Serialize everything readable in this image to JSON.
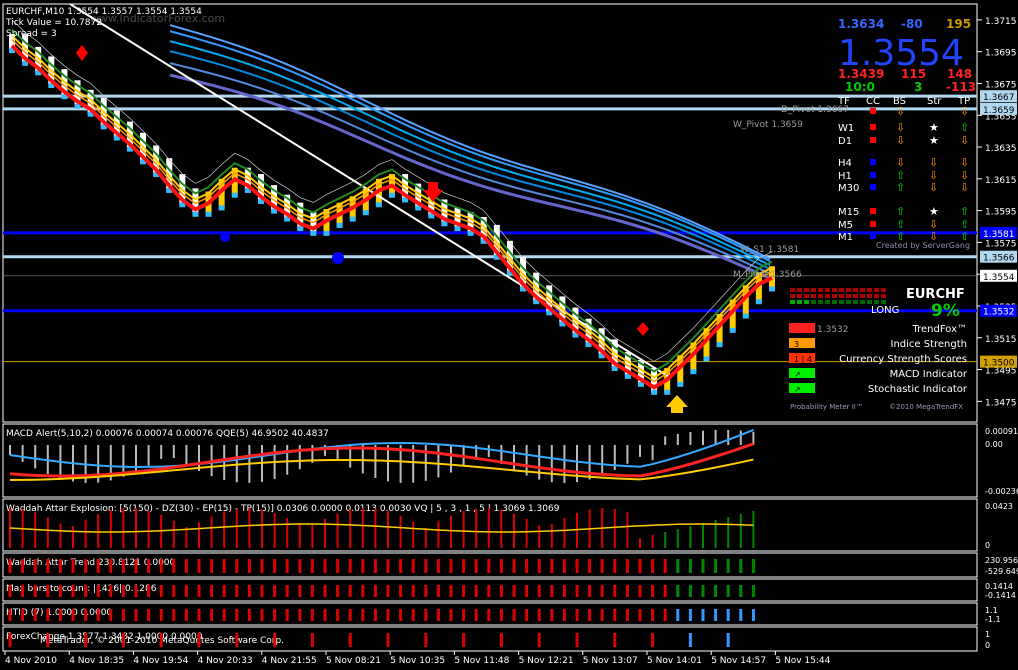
{
  "header": {
    "symbol_line": "EURCHF,M10 1.3554 1.3557 1.3554 1.3554",
    "tick_line": "Tick Value = 10.7872",
    "spread_line": "Spread = 3",
    "watermark": "www.IndicatorForex.com",
    "created_by": "Created by ServerGang",
    "copyright": "©2010 MegaTrendFX",
    "prob_meter": "Probability Meter II™"
  },
  "info_panel": {
    "top_price": "1.3634",
    "top_change": "-80",
    "top_pips": "195",
    "big_price": "1.3554",
    "low_price": "1.3439",
    "low_pips": "115",
    "low_range": "148",
    "ratio": "10:0",
    "ratio_b": "3",
    "ratio_c": "-113",
    "columns": [
      "TF",
      "CC",
      "BS",
      "Str",
      "TP"
    ],
    "timeframes": [
      {
        "tf": "MN",
        "cc": "#ff0000",
        "bs": "⇩",
        "bs_color": "#ff9900",
        "str": "",
        "tp": "⇩",
        "tp_color": "#ff9900"
      },
      {
        "tf": "W1",
        "cc": "#ff0000",
        "bs": "⇩",
        "bs_color": "#ff9900",
        "str": "★",
        "tp": "⇧",
        "tp_color": "#00dd00"
      },
      {
        "tf": "D1",
        "cc": "#ff0000",
        "bs": "⇩",
        "bs_color": "#ff9900",
        "str": "★",
        "tp": "⇩",
        "tp_color": "#ff9900"
      },
      {
        "tf": "H4",
        "cc": "#0000ff",
        "bs": "⇩",
        "bs_color": "#ff9900",
        "str": "⇩",
        "tp": "⇩",
        "tp_color": "#ff9900"
      },
      {
        "tf": "H1",
        "cc": "#0000ff",
        "bs": "⇧",
        "bs_color": "#00dd00",
        "str": "⇩",
        "tp": "⇩",
        "tp_color": "#ff9900"
      },
      {
        "tf": "M30",
        "cc": "#0000ff",
        "bs": "⇧",
        "bs_color": "#00dd00",
        "str": "⇩",
        "tp": "⇩",
        "tp_color": "#ff9900"
      },
      {
        "tf": "M15",
        "cc": "#ff0000",
        "bs": "⇧",
        "bs_color": "#00dd00",
        "str": "★",
        "tp": "⇧",
        "tp_color": "#00dd00"
      },
      {
        "tf": "M5",
        "cc": "#ff0000",
        "bs": "⇧",
        "bs_color": "#00dd00",
        "str": "⇩",
        "tp": "⇧",
        "tp_color": "#00dd00"
      },
      {
        "tf": "M1",
        "cc": "#0000ff",
        "bs": "⇧",
        "bs_color": "#00dd00",
        "str": "⇩",
        "tp": "⇧",
        "tp_color": "#00dd00"
      }
    ]
  },
  "trendfox": {
    "pair": "EURCHF",
    "direction": "LONG",
    "percent": "9%",
    "pivot_label": "1.3532",
    "rows": [
      {
        "label": "TrendFox™",
        "badge": "",
        "badge_color": "#ff2222"
      },
      {
        "label": "Indice Strength",
        "badge": "3",
        "badge_color": "#ff9900"
      },
      {
        "label": "Currency Strength Scores",
        "badge": "1 | 4",
        "badge_color": "#ff3300"
      },
      {
        "label": "MACD Indicator",
        "badge": "↗",
        "badge_color": "#00ee00"
      },
      {
        "label": "Stochastic Indicator",
        "badge": "↗",
        "badge_color": "#00ee00"
      }
    ]
  },
  "pivots": [
    {
      "label": "D_Pivot 1.3667",
      "price": 1.3667
    },
    {
      "label": "W_Pivot 1.3659",
      "price": 1.3659
    },
    {
      "label": "W_S1 1.3581",
      "price": 1.3581
    },
    {
      "label": "M_Pivot 1.3566",
      "price": 1.3566
    }
  ],
  "price_tags": [
    "1.3667",
    "1.3659",
    "1.3581",
    "1.3566",
    "1.3554",
    "1.3532",
    "1.3500"
  ],
  "subwindows": {
    "macd": {
      "title": "MACD Alert(5,10,2) 0.00076 0.00074 0.00076  QQE(5) 46.9502 40.4837",
      "top": "0.00091",
      "mid": "0.00",
      "bottom": "-0.00236"
    },
    "waddah": {
      "title": "Waddah Attar Explosion: [5(150) - DZ(30) - EP(15) - TP(15)] 0.0306 0.0000 0.0113 0.0030  VQ | 5 , 3 , 1 , 5 | 1.3069 1.3069",
      "top": "0.0423",
      "bottom": "0"
    },
    "trend": {
      "title": "Waddah Attar Trend 230.8121 0.0000",
      "top": "230.956",
      "bottom": "-529.649"
    },
    "maxbars": {
      "title": "Max bars to count: |1426|  0.1286",
      "top": "0.1414",
      "bottom": "-0.1414"
    },
    "htid": {
      "title": "HTID (7) 1.0000 0.0000",
      "top": "1.1",
      "bottom": "-1.1"
    },
    "forex": {
      "title": "ForexChange 1.3577 1.3482 1.0000 0.0000",
      "copyright": "MetaTrader, © 2001-2010 MetaQuotes Software Corp.",
      "top": "1",
      "bottom": "0"
    }
  },
  "chart_data": {
    "type": "line",
    "title": "EURCHF,M10",
    "x_ticks": [
      "4 Nov 2010",
      "4 Nov 18:35",
      "4 Nov 19:54",
      "4 Nov 20:33",
      "4 Nov 21:55",
      "5 Nov 08:21",
      "5 Nov 10:35",
      "5 Nov 11:48",
      "5 Nov 12:21",
      "5 Nov 13:07",
      "5 Nov 14:01",
      "5 Nov 14:57",
      "5 Nov 15:44"
    ],
    "y_ticks": [
      1.3715,
      1.3695,
      1.3675,
      1.3655,
      1.3635,
      1.3615,
      1.3595,
      1.3575,
      1.3555,
      1.3535,
      1.3515,
      1.3495,
      1.3475
    ],
    "ylim": [
      1.3462,
      1.3725
    ],
    "current_price": 1.3554,
    "horizontal_lines": [
      {
        "price": 1.3667,
        "color": "#b0d8f0"
      },
      {
        "price": 1.3659,
        "color": "#b0d8f0"
      },
      {
        "price": 1.3581,
        "color": "#0000ff"
      },
      {
        "price": 1.3566,
        "color": "#b0d8f0"
      },
      {
        "price": 1.3532,
        "color": "#0000ff"
      },
      {
        "price": 1.35,
        "color": "#d4a000"
      }
    ],
    "closes": [
      1.37,
      1.3692,
      1.3686,
      1.3678,
      1.3671,
      1.3665,
      1.366,
      1.3652,
      1.3645,
      1.3638,
      1.363,
      1.3622,
      1.3612,
      1.3603,
      1.3597,
      1.3601,
      1.3609,
      1.3616,
      1.3612,
      1.3605,
      1.3599,
      1.3594,
      1.3588,
      1.3585,
      1.359,
      1.3594,
      1.3598,
      1.3603,
      1.3609,
      1.3612,
      1.3606,
      1.3601,
      1.3596,
      1.3591,
      1.3588,
      1.3585,
      1.358,
      1.357,
      1.356,
      1.355,
      1.3542,
      1.3535,
      1.3528,
      1.3521,
      1.3515,
      1.3508,
      1.35,
      1.3495,
      1.349,
      1.3485,
      1.349,
      1.3498,
      1.3506,
      1.3515,
      1.3524,
      1.3533,
      1.3542,
      1.355,
      1.3554
    ]
  }
}
